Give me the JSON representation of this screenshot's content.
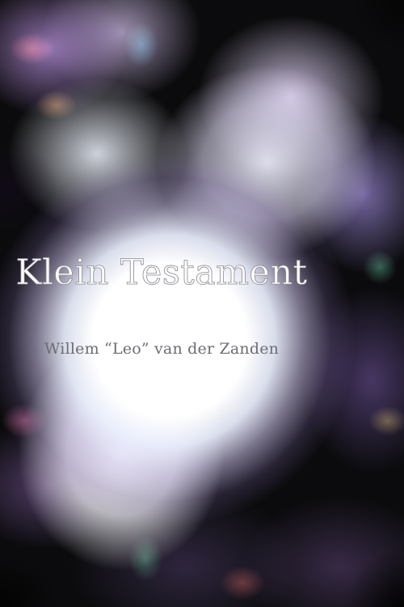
{
  "poster": {
    "title": "Klein Testament",
    "author": "Willem “Leo” van der Zanden"
  }
}
